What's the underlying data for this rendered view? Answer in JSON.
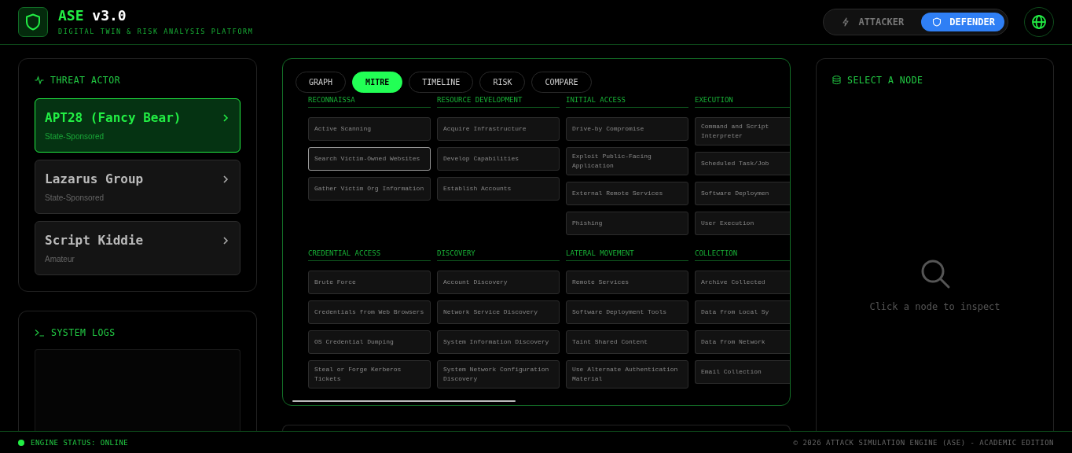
{
  "header": {
    "title_accent": "ASE",
    "title_rest": "v3.0",
    "subtitle": "DIGITAL TWIN & RISK ANALYSIS PLATFORM",
    "modes": [
      {
        "label": "ATTACKER",
        "kind": "attacker",
        "selected": false
      },
      {
        "label": "DEFENDER",
        "kind": "defender",
        "selected": true
      }
    ]
  },
  "threat_actor": {
    "title": "THREAT ACTOR",
    "actors": [
      {
        "name": "APT28 (Fancy Bear)",
        "type": "State-Sponsored",
        "selected": true
      },
      {
        "name": "Lazarus Group",
        "type": "State-Sponsored",
        "selected": false
      },
      {
        "name": "Script Kiddie",
        "type": "Amateur",
        "selected": false
      }
    ]
  },
  "system_logs": {
    "title": "SYSTEM LOGS"
  },
  "tabs": [
    {
      "label": "GRAPH",
      "selected": false
    },
    {
      "label": "MITRE",
      "selected": true
    },
    {
      "label": "TIMELINE",
      "selected": false
    },
    {
      "label": "RISK",
      "selected": false
    },
    {
      "label": "COMPARE",
      "selected": false
    }
  ],
  "mitre": [
    {
      "tactic": "RECONNAISSA",
      "techniques": [
        {
          "name": "Active Scanning",
          "selected": false
        },
        {
          "name": "Search Victim-Owned Websites",
          "selected": true
        },
        {
          "name": "Gather Victim Org Information",
          "selected": false
        }
      ]
    },
    {
      "tactic": "RESOURCE DEVELOPMENT",
      "techniques": [
        {
          "name": "Acquire Infrastructure",
          "selected": false
        },
        {
          "name": "Develop Capabilities",
          "selected": false
        },
        {
          "name": "Establish Accounts",
          "selected": false
        }
      ]
    },
    {
      "tactic": "INITIAL ACCESS",
      "techniques": [
        {
          "name": "Drive-by Compromise",
          "selected": false
        },
        {
          "name": "Exploit Public-Facing Application",
          "selected": false
        },
        {
          "name": "External Remote Services",
          "selected": false
        },
        {
          "name": "Phishing",
          "selected": false
        }
      ]
    },
    {
      "tactic": "EXECUTION",
      "techniques": [
        {
          "name": "Command and Script Interpreter",
          "selected": false
        },
        {
          "name": "Scheduled Task/Job",
          "selected": false
        },
        {
          "name": "Software Deploymen",
          "selected": false
        },
        {
          "name": "User Execution",
          "selected": false
        }
      ]
    },
    {
      "tactic": "CREDENTIAL ACCESS",
      "techniques": [
        {
          "name": "Brute Force",
          "selected": false
        },
        {
          "name": "Credentials from Web Browsers",
          "selected": false
        },
        {
          "name": "OS Credential Dumping",
          "selected": false
        },
        {
          "name": "Steal or Forge Kerberos Tickets",
          "selected": false
        }
      ]
    },
    {
      "tactic": "DISCOVERY",
      "techniques": [
        {
          "name": "Account Discovery",
          "selected": false
        },
        {
          "name": "Network Service Discovery",
          "selected": false
        },
        {
          "name": "System Information Discovery",
          "selected": false
        },
        {
          "name": "System Network Configuration Discovery",
          "selected": false
        }
      ]
    },
    {
      "tactic": "LATERAL MOVEMENT",
      "techniques": [
        {
          "name": "Remote Services",
          "selected": false
        },
        {
          "name": "Software Deployment Tools",
          "selected": false
        },
        {
          "name": "Taint Shared Content",
          "selected": false
        },
        {
          "name": "Use Alternate Authentication Material",
          "selected": false
        }
      ]
    },
    {
      "tactic": "COLLECTION",
      "techniques": [
        {
          "name": "Archive Collected",
          "selected": false
        },
        {
          "name": "Data from Local Sy",
          "selected": false
        },
        {
          "name": "Data from Network",
          "selected": false
        },
        {
          "name": "Email Collection",
          "selected": false
        }
      ]
    }
  ],
  "inspector": {
    "title": "SELECT A NODE",
    "hint": "Click a node to inspect"
  },
  "footer": {
    "status": "ENGINE STATUS: ONLINE",
    "copyright": "© 2026 ATTACK SIMULATION ENGINE (ASE) - ACADEMIC EDITION"
  }
}
